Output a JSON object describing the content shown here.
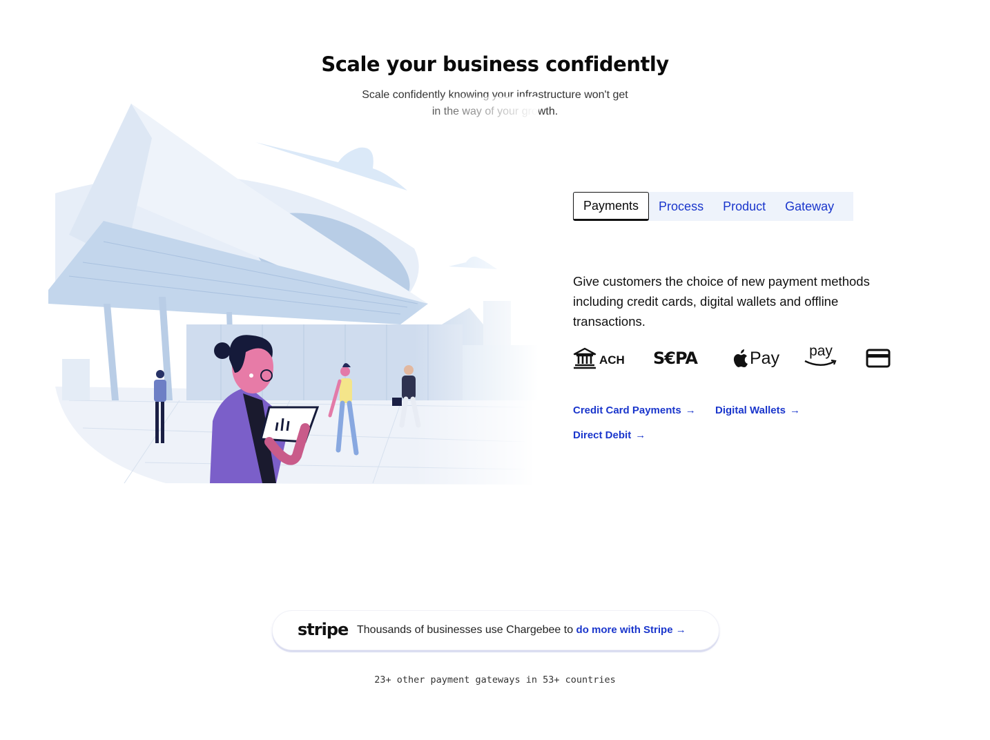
{
  "hero": {
    "title": "Scale your business confidently",
    "subtitle": "Scale confidently knowing your infrastructure won't get in the way of your growth."
  },
  "tabs": [
    {
      "label": "Payments",
      "active": true
    },
    {
      "label": "Process",
      "active": false
    },
    {
      "label": "Product",
      "active": false
    },
    {
      "label": "Gateway",
      "active": false
    }
  ],
  "payments": {
    "description": "Give customers the choice of new payment methods including credit cards, digital wallets and offline transactions.",
    "methods": [
      {
        "label": "ACH",
        "icon": "bank-icon"
      },
      {
        "label": "S€PA",
        "icon": "sepa-logo"
      },
      {
        "label": "Pay",
        "icon": "apple-pay-logo"
      },
      {
        "label": "pay",
        "icon": "amazon-pay-logo"
      },
      {
        "label": "",
        "icon": "credit-card-icon"
      }
    ],
    "links": [
      {
        "label": "Credit Card Payments"
      },
      {
        "label": "Digital Wallets"
      },
      {
        "label": "Direct Debit"
      }
    ]
  },
  "stripe": {
    "logo": "stripe",
    "text": "Thousands of businesses use Chargebee to ",
    "link": "do more with Stripe"
  },
  "gateways_note": "23+ other payment gateways in 53+ countries",
  "colors": {
    "accent": "#1a36cc",
    "tab_bg": "#eef3fb"
  }
}
